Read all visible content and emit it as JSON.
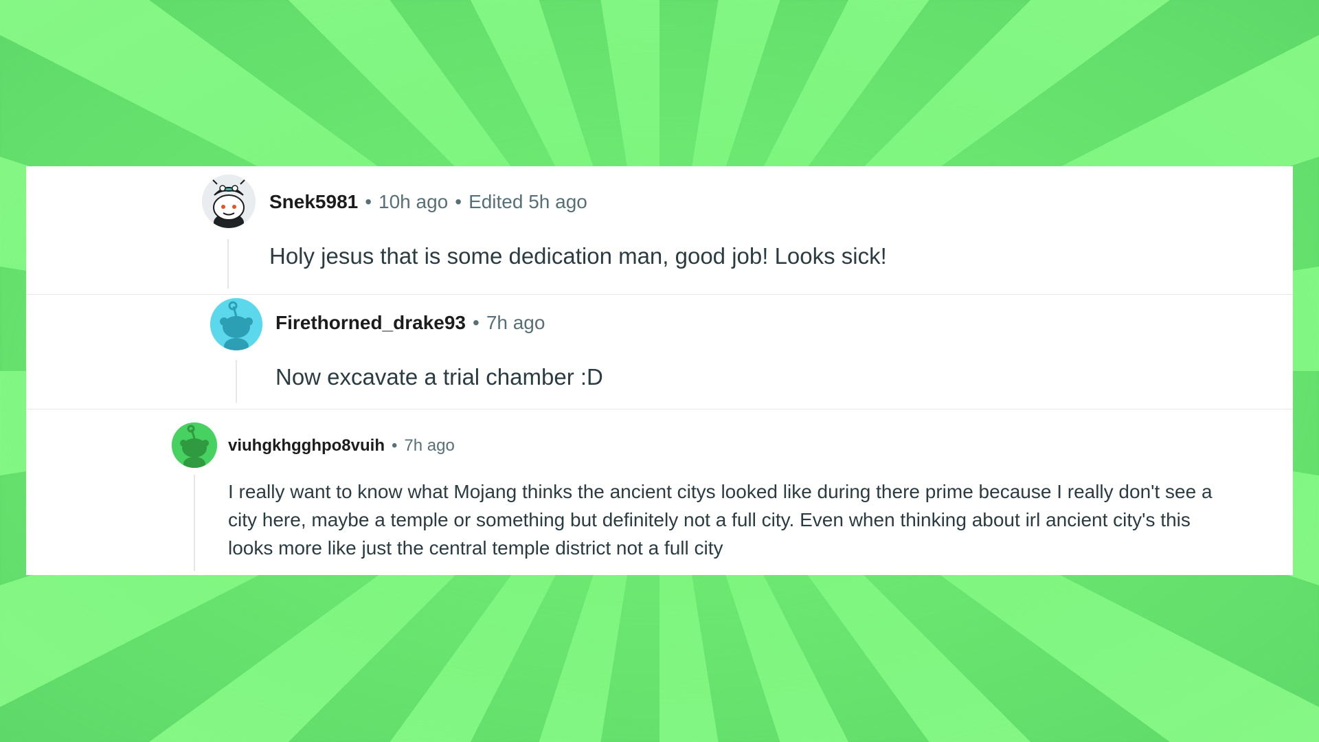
{
  "comments": [
    {
      "username": "Snek5981",
      "separator": "•",
      "time": "10h ago",
      "edited": "Edited 5h ago",
      "text": "Holy jesus that is some dedication man, good job! Looks sick!",
      "avatar_icon": "snoo-avatar-dragon-hat"
    },
    {
      "username": "Firethorned_drake93",
      "separator": "•",
      "time": "7h ago",
      "text": "Now excavate a trial chamber :D",
      "avatar_icon": "snoo-default-avatar",
      "avatar_color": "#5cd8ec"
    },
    {
      "username": "viuhgkhgghpo8vuih",
      "separator": "•",
      "time": "7h ago",
      "text": "I really want to know what Mojang thinks the ancient citys looked like during there prime because I really don't see a city here, maybe a temple or something but definitely not a full city. Even when thinking about irl ancient city's this looks more like just the central temple district not a full city",
      "avatar_icon": "snoo-default-avatar",
      "avatar_color": "#46d160"
    }
  ],
  "colors": {
    "background_light": "#86f786",
    "background_dark": "#5fd96a",
    "username": "#1c1c1c",
    "meta": "#576f76",
    "body": "#2a3c42"
  }
}
